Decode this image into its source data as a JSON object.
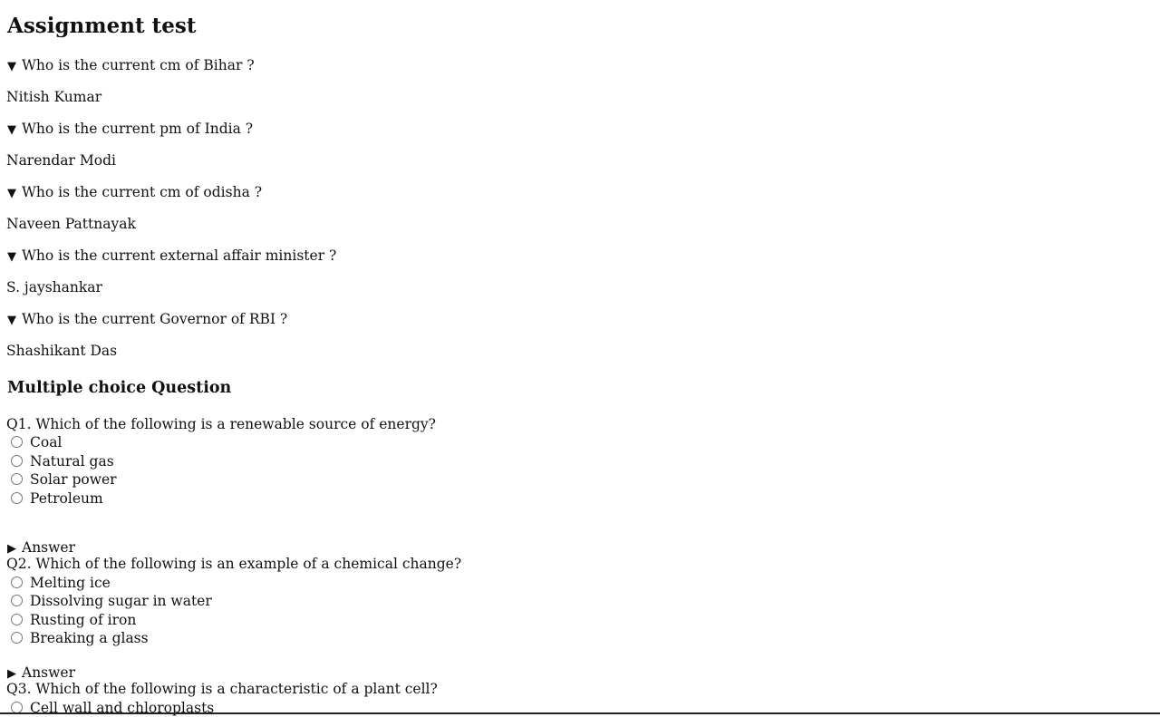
{
  "page_title": "Assignment test",
  "faq": [
    {
      "question": "Who is the current cm of Bihar ?",
      "answer": "Nitish Kumar"
    },
    {
      "question": "Who is the current pm of India ?",
      "answer": "Narendar Modi"
    },
    {
      "question": "Who is the current cm of odisha ?",
      "answer": "Naveen Pattnayak"
    },
    {
      "question": "Who is the current external affair minister ?",
      "answer": "S. jayshankar"
    },
    {
      "question": "Who is the current Governor of RBI ?",
      "answer": "Shashikant Das"
    }
  ],
  "markers": {
    "open": "▼",
    "closed": "▶"
  },
  "mcq_title": "Multiple choice Question",
  "mcq": [
    {
      "question": "Q1. Which of the following is a renewable source of energy?",
      "options": [
        "Coal",
        "Natural gas",
        "Solar power",
        "Petroleum"
      ],
      "answer_label": "Answer"
    },
    {
      "question": "Q2. Which of the following is an example of a chemical change?",
      "options": [
        "Melting ice",
        "Dissolving sugar in water",
        "Rusting of iron",
        "Breaking a glass"
      ],
      "answer_label": "Answer"
    },
    {
      "question": "Q3. Which of the following is a characteristic of a plant cell?",
      "options": [
        "Cell wall and chloroplasts"
      ]
    }
  ]
}
